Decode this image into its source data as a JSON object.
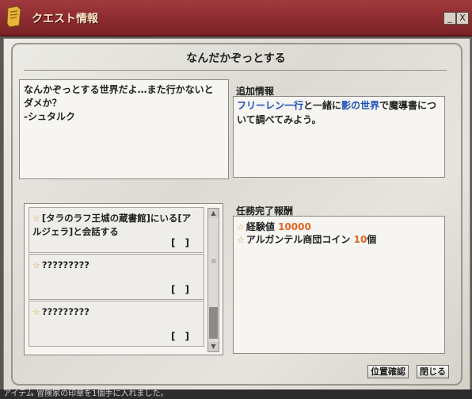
{
  "window": {
    "title": "クエスト情報",
    "min_label": "_",
    "close_label": "X"
  },
  "quest": {
    "name": "なんだかぞっとする",
    "description_line1": "なんかぞっとする世界だよ…また行かないと",
    "description_line2": "ダメか？",
    "description_line3": "-シュタルク"
  },
  "extra": {
    "heading": "追加情報",
    "part1": "フリーレン一行",
    "part2": "と一緒に",
    "part3": "影の世界",
    "part4": "で魔導書につ",
    "part5": "いて調べてみよう。"
  },
  "objectives": [
    {
      "line1": "[タラのラフ王城の蔵書館]にいる[ア",
      "line2": "ルジェラ]と会話する",
      "status": "[　]"
    },
    {
      "line1": "?????????",
      "line2": "",
      "status": "[　]"
    },
    {
      "line1": "?????????",
      "line2": "",
      "status": "[　]"
    }
  ],
  "rewards": {
    "heading": "任務完了報酬",
    "items": [
      {
        "label": "経験値",
        "value": "10000",
        "suffix": ""
      },
      {
        "label": "アルガンテル商団コイン",
        "value": "10",
        "suffix": "個"
      }
    ]
  },
  "buttons": {
    "locate": "位置確認",
    "close": "閉じる"
  },
  "footer": {
    "text": "アイテム 冒険家の印章を1個手に入れました。"
  }
}
